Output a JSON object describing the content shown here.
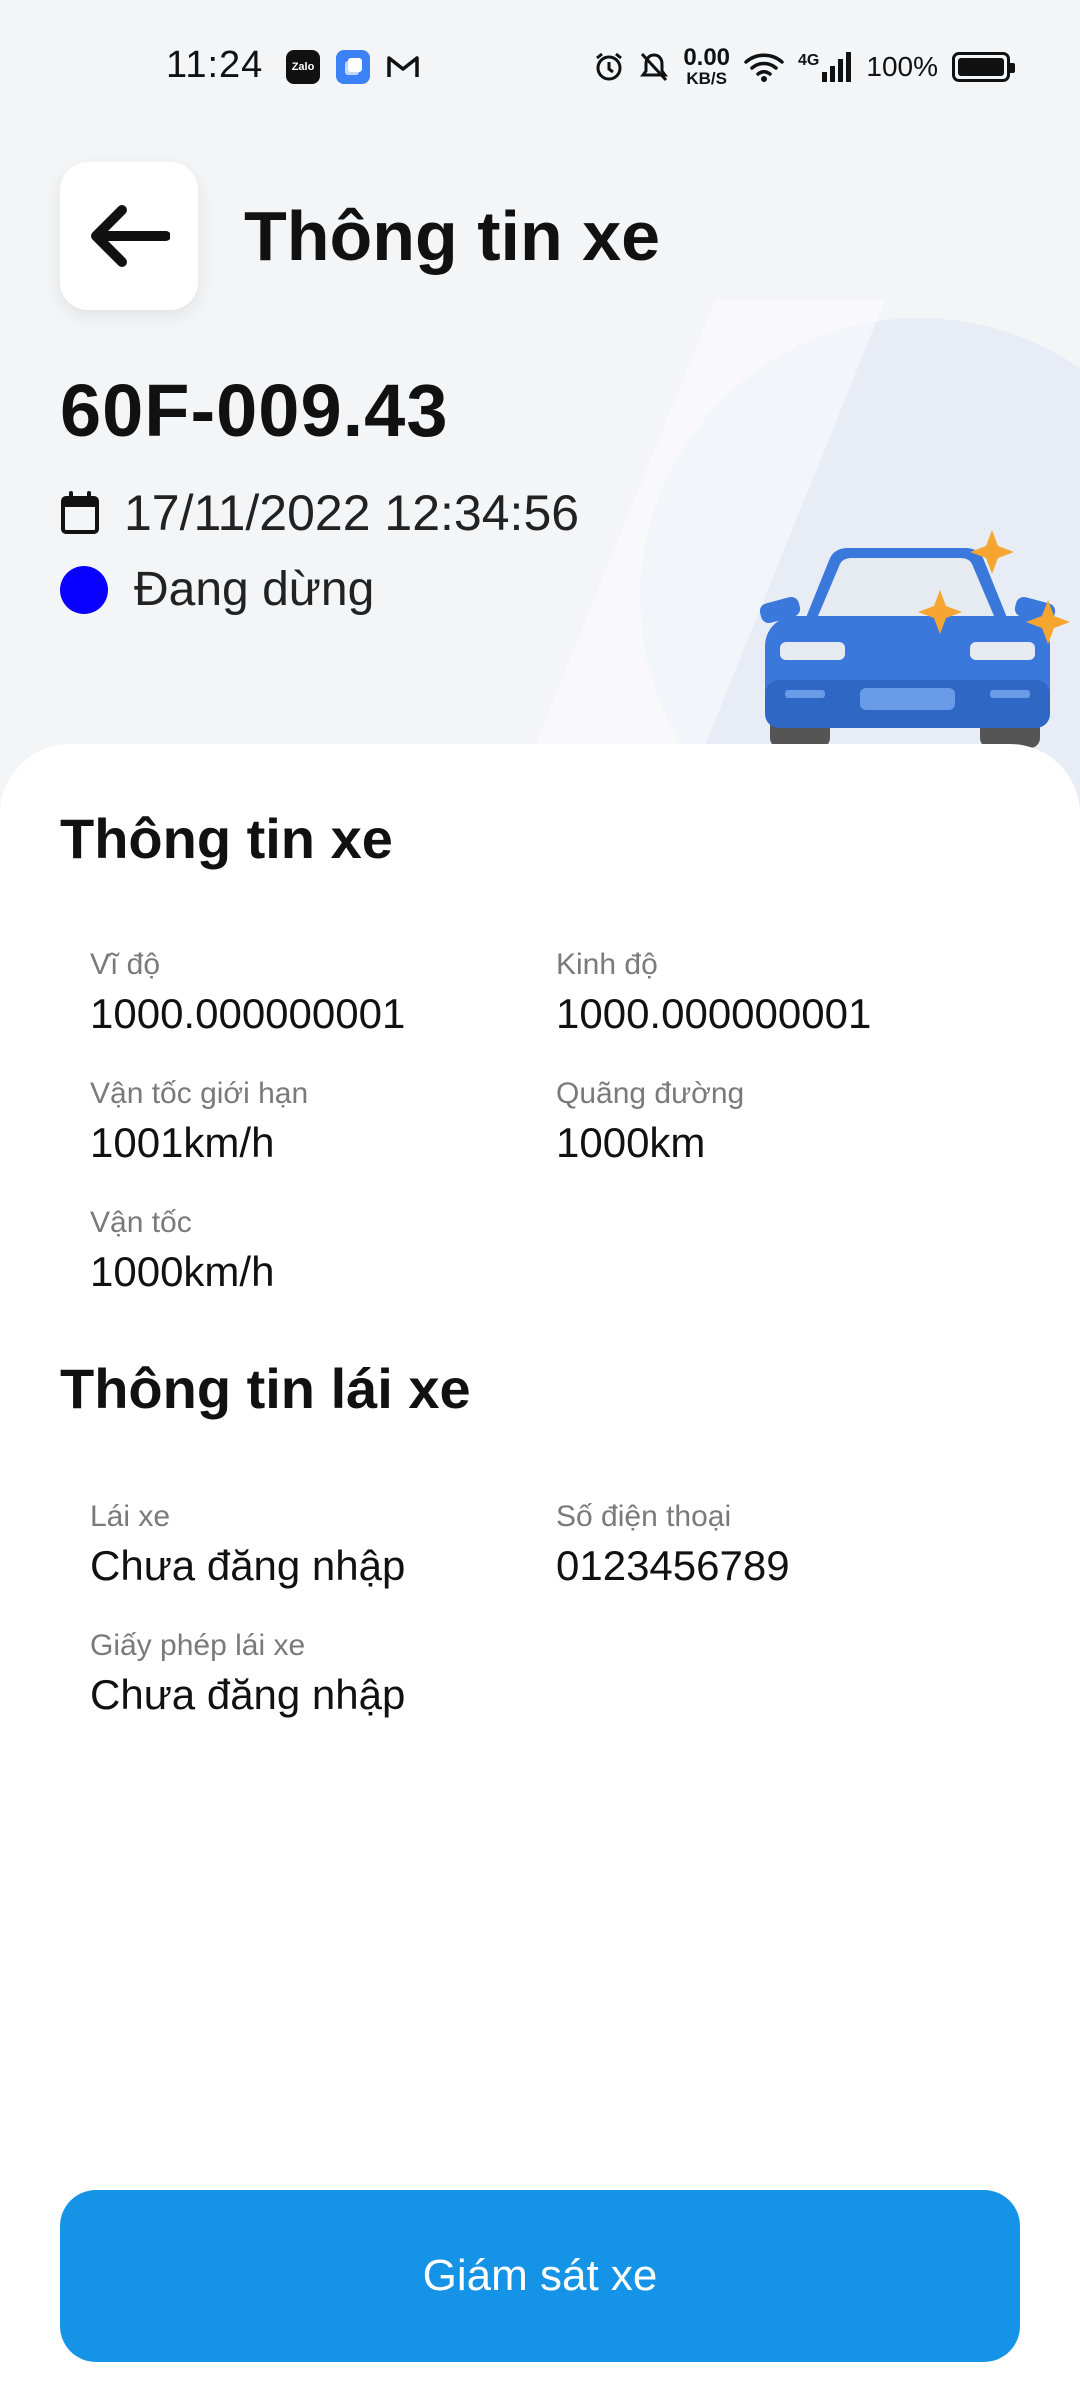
{
  "status_bar": {
    "time": "11:24",
    "apps": [
      "Zalo",
      "files-icon",
      "gmail-icon"
    ],
    "net_speed_value": "0.00",
    "net_speed_unit": "KB/S",
    "network": "4G",
    "battery": "100%"
  },
  "header": {
    "title": "Thông tin xe"
  },
  "vehicle": {
    "plate": "60F-009.43",
    "datetime": "17/11/2022 12:34:56",
    "status": "Đang dừng",
    "status_color": "#0a00ff"
  },
  "vehicle_info": {
    "title": "Thông tin xe",
    "latitude_label": "Vĩ độ",
    "latitude_value": "1000.000000001",
    "longitude_label": "Kinh độ",
    "longitude_value": "1000.000000001",
    "speed_limit_label": "Vận tốc giới hạn",
    "speed_limit_value": "1001km/h",
    "distance_label": "Quãng đường",
    "distance_value": "1000km",
    "speed_label": "Vận tốc",
    "speed_value": "1000km/h"
  },
  "driver_info": {
    "title": "Thông tin lái xe",
    "driver_label": "Lái xe",
    "driver_value": "Chưa đăng nhập",
    "phone_label": "Số điện thoại",
    "phone_value": "0123456789",
    "license_label": "Giấy phép lái xe",
    "license_value": "Chưa đăng nhập"
  },
  "actions": {
    "monitor_label": "Giám sát xe"
  },
  "colors": {
    "primary": "#1593e6",
    "car_body": "#3b78db",
    "sparkle": "#f6a531"
  }
}
